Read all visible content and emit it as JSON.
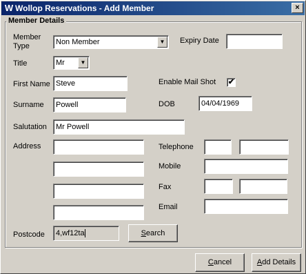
{
  "window": {
    "app_icon": "W",
    "title": "Wollop Reservations - Add Member",
    "close_glyph": "×"
  },
  "group": {
    "title": "Member Details"
  },
  "labels": {
    "member_type_line1": "Member",
    "member_type_line2": "Type",
    "expiry_date": "Expiry Date",
    "title": "Title",
    "first_name": "First Name",
    "enable_mail_shot": "Enable Mail Shot",
    "surname": "Surname",
    "dob": "DOB",
    "salutation": "Salutation",
    "address": "Address",
    "telephone": "Telephone",
    "mobile": "Mobile",
    "fax": "Fax",
    "email": "Email",
    "postcode": "Postcode"
  },
  "values": {
    "member_type": "Non Member",
    "expiry_date": "",
    "title": "Mr",
    "first_name": "Steve",
    "enable_mail_shot": "✔",
    "surname": "Powell",
    "dob": "04/04/1969",
    "salutation": "Mr Powell",
    "address_1": "",
    "address_2": "",
    "address_3": "",
    "address_4": "",
    "telephone_code": "",
    "telephone_number": "",
    "mobile": "",
    "fax_code": "",
    "fax_number": "",
    "email": "",
    "postcode": "4,wf12ta"
  },
  "buttons": {
    "search_accel": "S",
    "search_rest": "earch",
    "cancel_accel": "C",
    "cancel_rest": "ancel",
    "add_accel": "A",
    "add_rest": "dd Details"
  }
}
